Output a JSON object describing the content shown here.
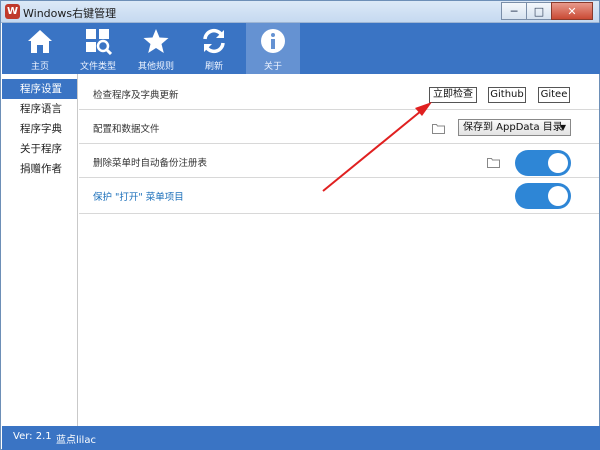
{
  "window": {
    "title": "Windows右键管理",
    "icon": "app-logo-icon"
  },
  "controls": {
    "minimize": "─",
    "maximize": "□",
    "close": "✕"
  },
  "toolbar": [
    {
      "label": "主页",
      "icon": "home-icon"
    },
    {
      "label": "文件类型",
      "icon": "file-types-icon"
    },
    {
      "label": "其他规则",
      "icon": "star-icon"
    },
    {
      "label": "刷新",
      "icon": "refresh-icon"
    },
    {
      "label": "关于",
      "icon": "info-icon",
      "active": true
    }
  ],
  "sidebar": {
    "items": [
      {
        "label": "程序设置",
        "active": true
      },
      {
        "label": "程序语言"
      },
      {
        "label": "程序字典"
      },
      {
        "label": "关于程序"
      },
      {
        "label": "捐赠作者"
      }
    ]
  },
  "settings": {
    "check_update": {
      "label": "检查程序及字典更新",
      "check_now": "立即检查",
      "github": "Github",
      "gitee": "Gitee"
    },
    "config": {
      "label": "配置和数据文件",
      "dropdown_value": "保存到 AppData 目录"
    },
    "backup": {
      "label": "删除菜单时自动备份注册表",
      "enabled": true
    },
    "protect": {
      "label": "保护 \"打开\" 菜单项目",
      "enabled": true
    }
  },
  "status": {
    "version": "Ver: 2.1",
    "author": "蓝点lilac"
  },
  "colors": {
    "accent": "#3a74c4",
    "toggle_on": "#2e86d6",
    "annotation": "#e02020",
    "link": "#1b6fba"
  }
}
